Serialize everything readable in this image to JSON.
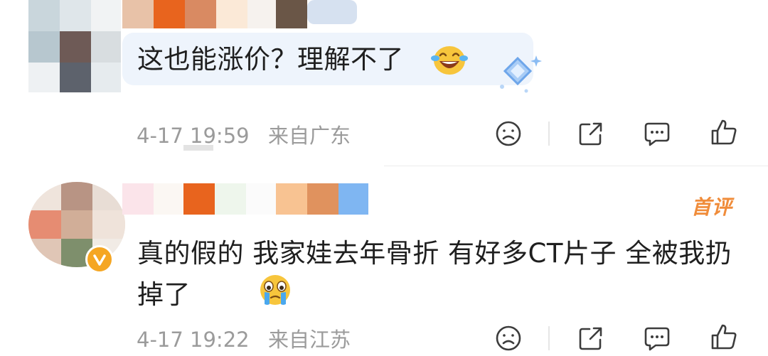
{
  "comments": [
    {
      "text": "这也能涨价？理解不了",
      "emoji": "laughing-tears-icon",
      "timestamp": "4-17 19:59",
      "location": "来自广东"
    },
    {
      "badge": "首评",
      "text": "真的假的 我家娃去年骨折 有好多CT片子 全被我扔掉了",
      "emoji": "crying-icon",
      "timestamp": "4-17 19:22",
      "location": "来自江苏"
    }
  ],
  "colors": {
    "bubble": "#eef4fc",
    "meta_text": "#9b9b9b",
    "first_badge": "#f08c3a",
    "verify_badge": "#f5a623"
  }
}
